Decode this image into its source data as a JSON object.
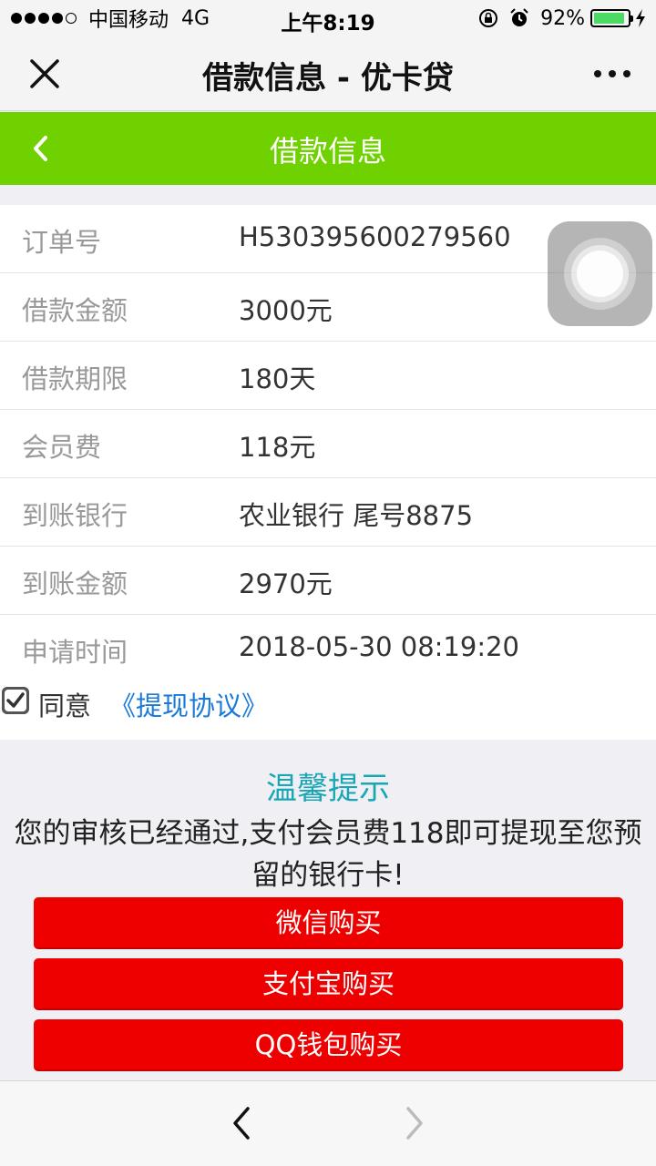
{
  "status_bar": {
    "carrier": "中国移动",
    "network": "4G",
    "time": "上午8:19",
    "battery_percent_text": "92%",
    "battery_level": 0.92,
    "battery_color": "#4cd964",
    "icons": [
      "signal-dots",
      "orientation-lock-icon",
      "alarm-icon",
      "battery-icon",
      "charging-bolt-icon"
    ]
  },
  "titlebar": {
    "title": "借款信息 - 优卡贷",
    "close_icon": "close-icon",
    "more_icon": "more-icon"
  },
  "header": {
    "title": "借款信息",
    "back_icon": "chevron-left-icon",
    "color": "#6fd100"
  },
  "info": {
    "rows": [
      {
        "label": "订单号",
        "value": "H530395600279560"
      },
      {
        "label": "借款金额",
        "value": "3000元"
      },
      {
        "label": "借款期限",
        "value": "180天"
      },
      {
        "label": "会员费",
        "value": "118元"
      },
      {
        "label": "到账银行",
        "value": "农业银行 尾号8875"
      },
      {
        "label": "到账金额",
        "value": "2970元"
      },
      {
        "label": "申请时间",
        "value": "2018-05-30 08:19:20"
      }
    ]
  },
  "agreement": {
    "checked": true,
    "agree_label": "同意",
    "link_label": "《提现协议》",
    "link_color": "#1a7ad8"
  },
  "tip": {
    "title": "温馨提示",
    "text": "您的审核已经通过,支付会员费118即可提现至您预留的银行卡!",
    "title_color": "#1aa7b5"
  },
  "buttons": {
    "wechat": "微信购买",
    "alipay": "支付宝购买",
    "qq": "QQ钱包购买",
    "color": "#ee0000"
  },
  "bottom_nav": {
    "back_icon": "chevron-left-icon",
    "forward_icon": "chevron-right-icon"
  }
}
